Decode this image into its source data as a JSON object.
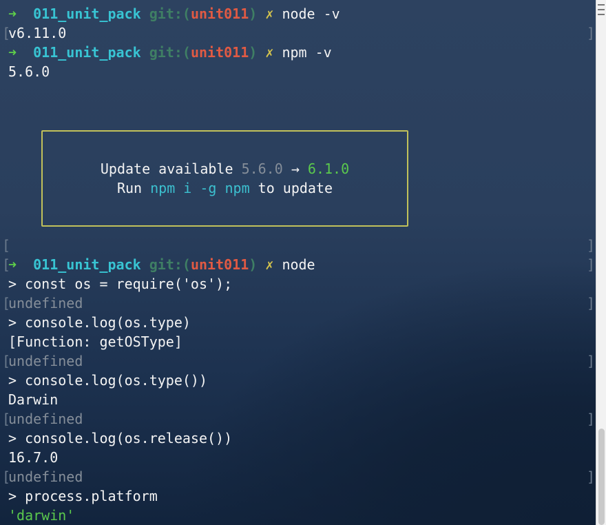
{
  "prompt": {
    "arrow": "➜",
    "dir": "011_unit_pack",
    "git_label": "git:(",
    "branch": "unit011",
    "git_close": ")",
    "dirty_mark": "✗"
  },
  "commands": {
    "node_version": "node -v",
    "npm_version": "npm -v",
    "node_repl": "node"
  },
  "outputs": {
    "node_version": "v6.11.0",
    "npm_version": "5.6.0"
  },
  "update_notice": {
    "prefix": "Update available ",
    "current": "5.6.0",
    "sep": " → ",
    "latest": "6.1.0",
    "run": "Run ",
    "command": "npm i -g npm",
    "suffix": " to update"
  },
  "repl": [
    {
      "input": "> const os = require('os');",
      "output": "undefined",
      "output_style": "dim"
    },
    {
      "input": "> console.log(os.type)",
      "output": "[Function: getOSType]",
      "output_style": "normal"
    },
    {
      "output": "undefined",
      "output_style": "dim"
    },
    {
      "input": "> console.log(os.type())",
      "output": "Darwin",
      "output_style": "normal"
    },
    {
      "output": "undefined",
      "output_style": "dim"
    },
    {
      "input": "> console.log(os.release())",
      "output": "16.7.0",
      "output_style": "normal"
    },
    {
      "output": "undefined",
      "output_style": "dim"
    },
    {
      "input": "> process.platform",
      "output": "'darwin'",
      "output_style": "green"
    }
  ],
  "brackets": {
    "left": "[",
    "right": "]"
  },
  "colors": {
    "background": "#2a3f5d",
    "prompt_arrow": "#5ecf4a",
    "dir": "#38c4d3",
    "branch": "#e15a43",
    "update_border": "#c2c25a"
  }
}
